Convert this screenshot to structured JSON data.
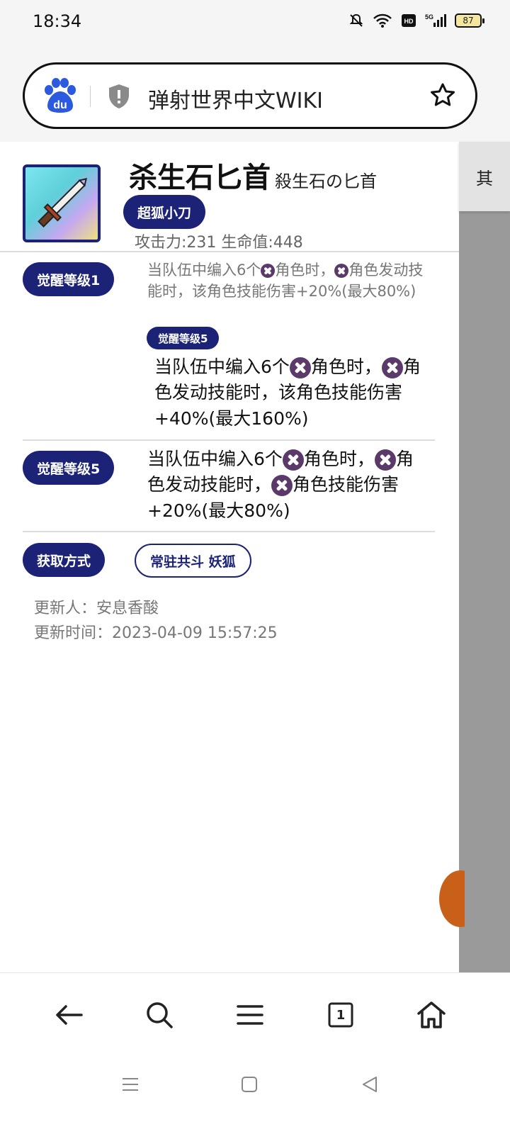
{
  "status_bar": {
    "time": "18:34",
    "battery": "87"
  },
  "browser": {
    "url_text": "弹射世界中文WIKI"
  },
  "side_tab": {
    "label": "其"
  },
  "item": {
    "title": "杀生石匕首",
    "subtitle": "殺生石の匕首",
    "tag": "超狐小刀",
    "stats": "攻击力:231 生命值:448"
  },
  "awakening1": {
    "label": "觉醒等级1",
    "desc_parts": [
      "当队伍中编入6个",
      "角色时，",
      "角色发动技能时，该角色技能伤害+20%(最大80%)"
    ],
    "sub_label": "觉醒等级5",
    "sub_desc_parts": [
      "当队伍中编入6个",
      "角色时，",
      "角色发动技能时，该角色技能伤害+40%(最大160%)"
    ]
  },
  "awakening5": {
    "label": "觉醒等级5",
    "desc_parts": [
      "当队伍中编入6个",
      "角色时，",
      "角色发动技能时，",
      "角色技能伤害+20%(最大80%)"
    ]
  },
  "acquire": {
    "label": "获取方式",
    "value": "常驻共斗 妖狐"
  },
  "meta": {
    "updater": "更新人：安息香酸",
    "update_time": "更新时间：2023-04-09 15:57:25"
  },
  "colors": {
    "accent": "#1c2377",
    "element_icon": "#5b3a6b"
  },
  "nav": {
    "back": "back-arrow-icon",
    "search": "search-icon",
    "menu": "menu-icon",
    "tabs_count": "1",
    "home": "home-icon"
  }
}
